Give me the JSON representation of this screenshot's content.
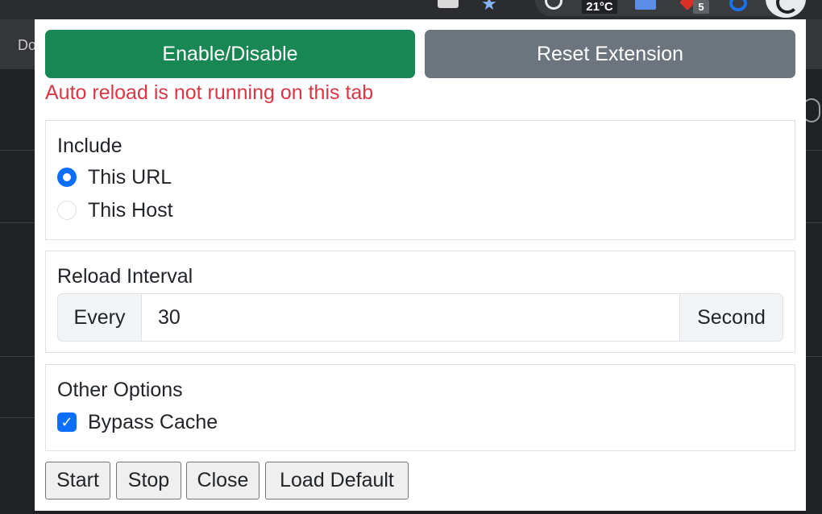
{
  "browser": {
    "bookmark_label": "Do",
    "weather_temp": "21°C",
    "notification_count": "5"
  },
  "popup": {
    "enable_button": "Enable/Disable",
    "reset_button": "Reset Extension",
    "status_message": "Auto reload is not running on this tab",
    "include": {
      "title": "Include",
      "options": [
        {
          "label": "This URL",
          "selected": true
        },
        {
          "label": "This Host",
          "selected": false
        }
      ]
    },
    "reload_interval": {
      "title": "Reload Interval",
      "prefix": "Every",
      "value": "30",
      "unit": "Second"
    },
    "other_options": {
      "title": "Other Options",
      "bypass_cache_label": "Bypass Cache",
      "bypass_cache_checked": true
    },
    "actions": {
      "start": "Start",
      "stop": "Stop",
      "close": "Close",
      "load_default": "Load Default"
    }
  },
  "colors": {
    "enable_green": "#198754",
    "reset_gray": "#6c757d",
    "status_red": "#dc3545",
    "accent_blue": "#0d6efd"
  }
}
